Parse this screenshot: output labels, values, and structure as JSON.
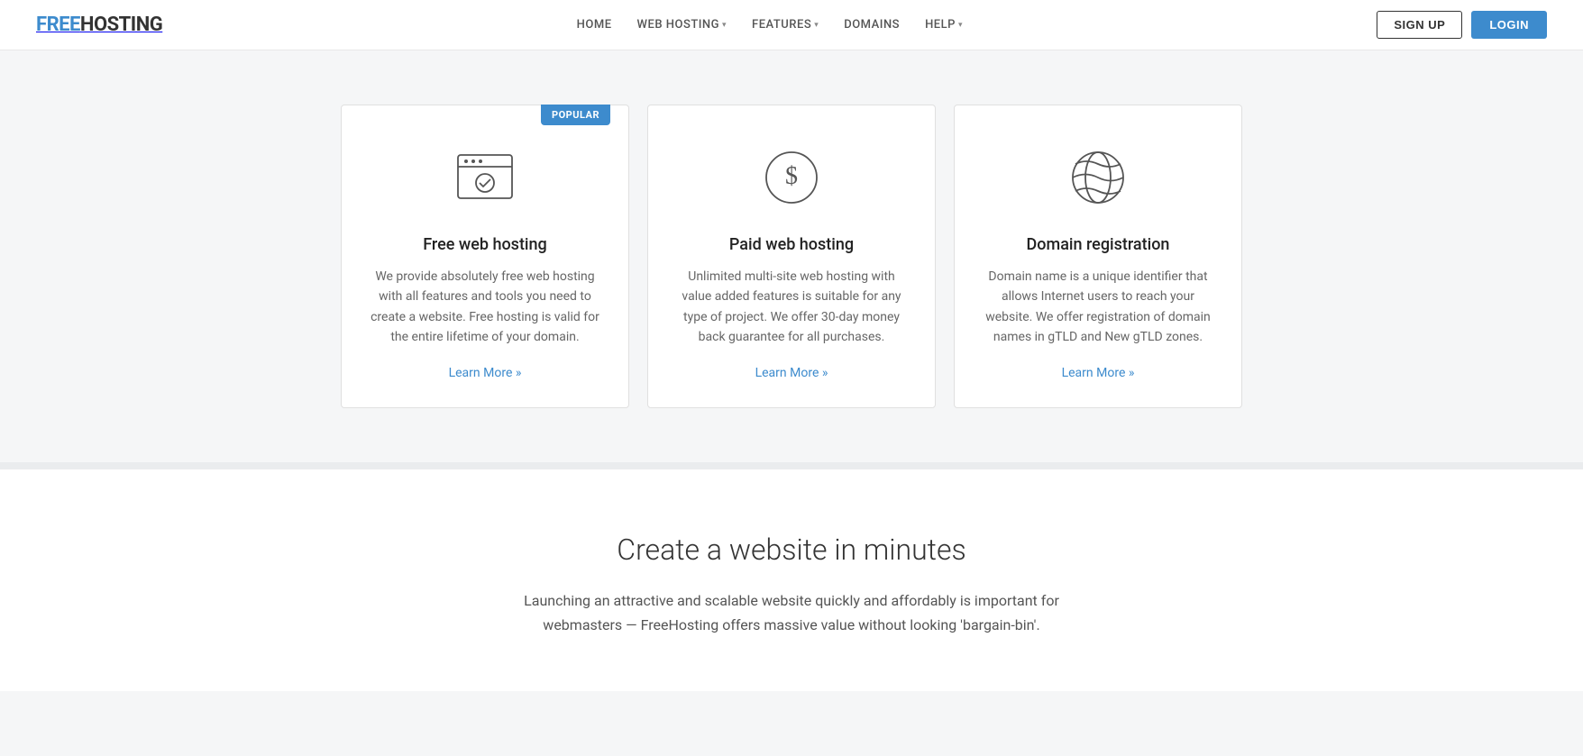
{
  "header": {
    "logo_free": "FREE",
    "logo_hosting": "HOSTING",
    "nav": {
      "home": "HOME",
      "web_hosting": "WEB HOSTING",
      "features": "FEATURES",
      "domains": "DOMAINS",
      "help": "HELP"
    },
    "signup_label": "SIGN UP",
    "login_label": "LOGIN"
  },
  "cards": [
    {
      "id": "free-hosting",
      "popular": true,
      "popular_label": "POPULAR",
      "icon": "browser-check",
      "title": "Free web hosting",
      "description": "We provide absolutely free web hosting with all features and tools you need to create a website. Free hosting is valid for the entire lifetime of your domain.",
      "link_label": "Learn More »"
    },
    {
      "id": "paid-hosting",
      "popular": false,
      "icon": "dollar-circle",
      "title": "Paid web hosting",
      "description": "Unlimited multi-site web hosting with value added features is suitable for any type of project. We offer 30-day money back guarantee for all purchases.",
      "link_label": "Learn More »"
    },
    {
      "id": "domain-registration",
      "popular": false,
      "icon": "globe",
      "title": "Domain registration",
      "description": "Domain name is a unique identifier that allows Internet users to reach your website. We offer registration of domain names in gTLD and New gTLD zones.",
      "link_label": "Learn More »"
    }
  ],
  "create_section": {
    "title": "Create a website in minutes",
    "description": "Launching an attractive and scalable website quickly and affordably is important for webmasters — FreeHosting offers massive value without looking 'bargain-bin'."
  }
}
